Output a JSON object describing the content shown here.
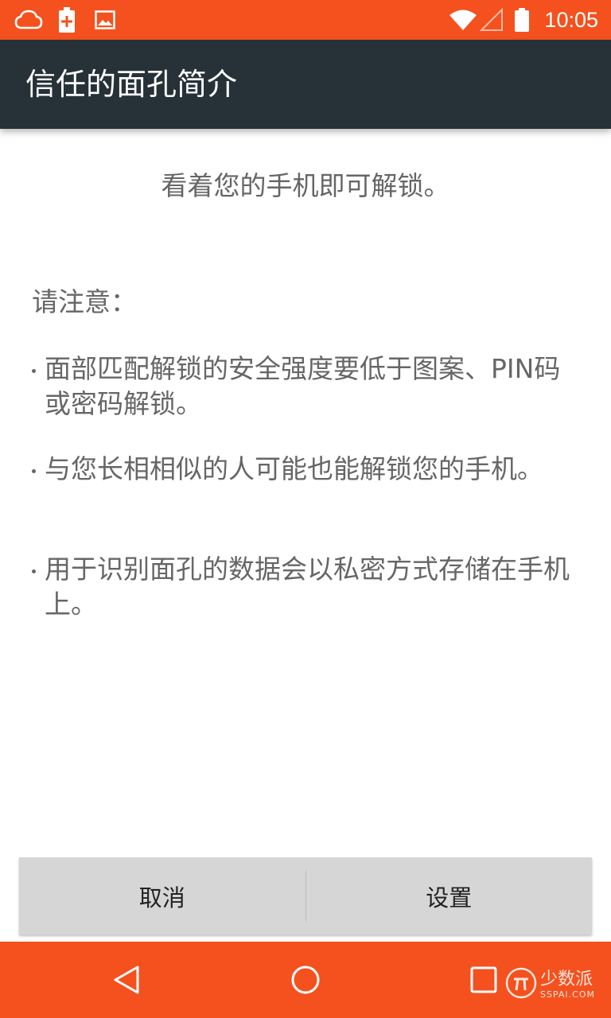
{
  "status_bar": {
    "time": "10:05",
    "icons": [
      "cloud-icon",
      "battery-plus-icon",
      "image-icon",
      "wifi-icon",
      "signal-icon",
      "battery-icon"
    ]
  },
  "app_bar": {
    "title": "信任的面孔简介"
  },
  "main": {
    "headline": "看着您的手机即可解锁。",
    "note_title": "请注意：",
    "bullets": [
      "面部匹配解锁的安全强度要低于图案、PIN码或密码解锁。",
      "与您长相相似的人可能也能解锁您的手机。",
      "用于识别面孔的数据会以私密方式存储在手机上。"
    ]
  },
  "buttons": {
    "cancel": "取消",
    "settings": "设置"
  },
  "nav_bar": {
    "icons": [
      "back-icon",
      "home-icon",
      "recents-icon"
    ]
  },
  "watermark": {
    "cn": "少数派",
    "en": "SSPAI.COM"
  },
  "colors": {
    "accent": "#f4511e",
    "app_bar": "#263238",
    "text": "#666666",
    "button_bg": "#d6d6d6"
  }
}
